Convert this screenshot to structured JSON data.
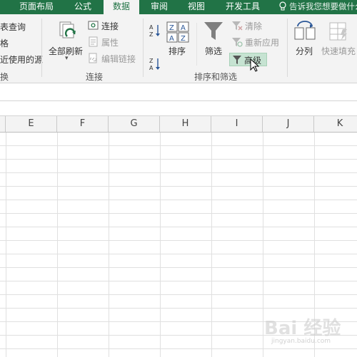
{
  "tabs": [
    "页面布局",
    "公式",
    "数据",
    "审阅",
    "视图",
    "开发工具"
  ],
  "active_tab": "数据",
  "tell_me": "告诉我您想要做什么",
  "get_transform": {
    "items": [
      "表查询",
      "格",
      "近使用的源"
    ],
    "group_label": "换"
  },
  "connections": {
    "refresh_all": "全部刷新",
    "connections": "连接",
    "properties": "属性",
    "edit_links": "编辑链接",
    "group_label": "连接"
  },
  "sort_filter": {
    "sort": "排序",
    "filter": "筛选",
    "clear": "清除",
    "reapply": "重新应用",
    "advanced": "高级",
    "group_label": "排序和筛选"
  },
  "data_tools": {
    "text_to_columns": "分列",
    "flash_fill": "快速填充"
  },
  "column_headers": [
    "E",
    "F",
    "G",
    "H",
    "I",
    "J",
    "K"
  ],
  "watermark": "Bai 经验",
  "watermark_sub": "jingyan.baidu.com",
  "colors": {
    "accent": "#217346",
    "highlight": "#c6e3d2",
    "grid": "#e0e0e0"
  }
}
